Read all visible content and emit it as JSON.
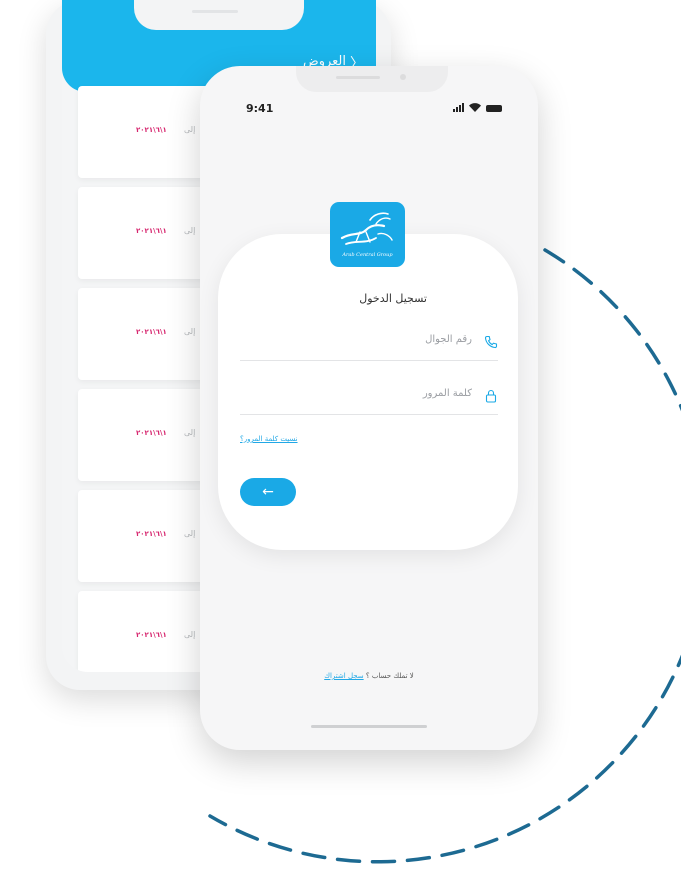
{
  "colors": {
    "brand_blue": "#1aa9e6",
    "header_blue": "#1bb6ec",
    "date_pink": "#d6246d",
    "dashed_circle": "#1d6a92"
  },
  "offers_screen": {
    "title": "العروض",
    "back_icon": "chevron-right-icon",
    "cards": [
      {
        "date": "١\\٦\\٢٠٢١",
        "to": "إلى"
      },
      {
        "date": "١\\٦\\٢٠٢١",
        "to": "إلى"
      },
      {
        "date": "١\\٦\\٢٠٢١",
        "to": "إلى"
      },
      {
        "date": "١\\٦\\٢٠٢١",
        "to": "إلى"
      },
      {
        "date": "١\\٦\\٢٠٢١",
        "to": "إلى"
      },
      {
        "date": "١\\٦\\٢٠٢١",
        "to": "إلى"
      }
    ]
  },
  "login_screen": {
    "status_time": "9:41",
    "logo_text": "Arab Central Group",
    "title": "تسجيل الدخول",
    "phone_field": {
      "placeholder": "رقم الجوال",
      "icon": "phone-icon"
    },
    "password_field": {
      "placeholder": "كلمة المرور",
      "icon": "lock-icon"
    },
    "forgot_password": "نسيت كلمة المرور؟",
    "submit_icon": "arrow-left-icon",
    "signup_prompt": "لا تملك حساب ؟",
    "signup_link": "سجل اشتراك"
  }
}
